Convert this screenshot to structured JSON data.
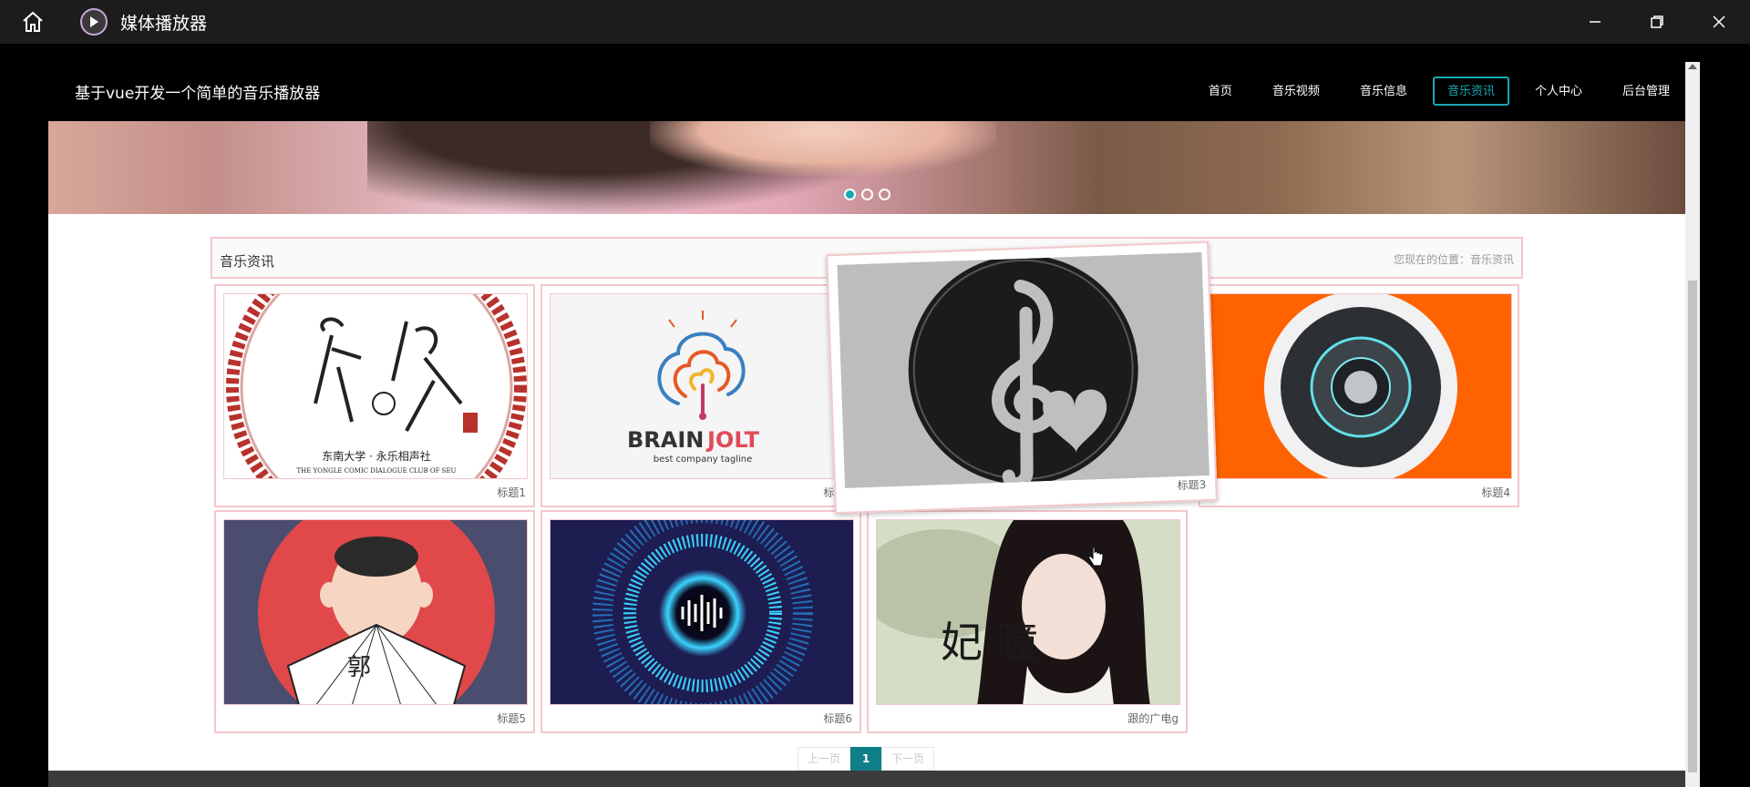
{
  "window": {
    "title": "媒体播放器"
  },
  "site": {
    "title": "基于vue开发一个简单的音乐播放器",
    "nav": [
      {
        "label": "首页",
        "active": false
      },
      {
        "label": "音乐视频",
        "active": false
      },
      {
        "label": "音乐信息",
        "active": false
      },
      {
        "label": "音乐资讯",
        "active": true
      },
      {
        "label": "个人中心",
        "active": false
      },
      {
        "label": "后台管理",
        "active": false
      }
    ]
  },
  "banner": {
    "dots": 3,
    "active_dot": 0
  },
  "news": {
    "title": "音乐资讯",
    "breadcrumb": "您现在的位置：音乐资讯",
    "items": [
      {
        "caption": "标题1",
        "image": "yongle-comic-club-logo",
        "logo_text_top": "东南大学 · 永乐相声社",
        "logo_text_bottom": "THE YONGLE COMIC DIALOGUE CLUB OF SEU"
      },
      {
        "caption": "标题2",
        "image": "brainjolt-logo",
        "logo_brand_a": "BRAIN",
        "logo_brand_b": "JOLT",
        "logo_tagline": "best company tagline"
      },
      {
        "caption": "标题3",
        "image": "treble-clef-heart"
      },
      {
        "caption": "标题4",
        "image": "speaker-orange"
      },
      {
        "caption": "标题5",
        "image": "cartoon-man-fan",
        "fan_text": "郭"
      },
      {
        "caption": "标题6",
        "image": "sound-wave-circle"
      },
      {
        "caption": "跟的广电g",
        "image": "actress-poster",
        "poster_text": "妃 瞳"
      }
    ]
  },
  "pager": {
    "prev": "上一页",
    "current": "1",
    "next": "下一页"
  },
  "colors": {
    "accent": "#19a7b2",
    "card_border": "#f4c7cb",
    "pager_active": "#0f7f87"
  }
}
